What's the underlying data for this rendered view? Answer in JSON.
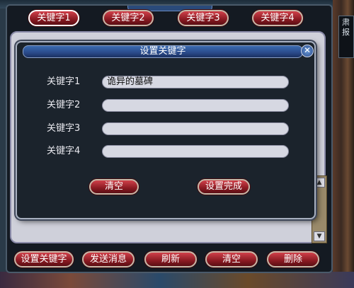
{
  "side_panel": {
    "text": "肃\n报"
  },
  "tabs": [
    {
      "label": "关键字1",
      "active": true
    },
    {
      "label": "关键字2",
      "active": false
    },
    {
      "label": "关键字3",
      "active": false
    },
    {
      "label": "关键字4",
      "active": false
    }
  ],
  "dialog": {
    "title": "设置关键字",
    "close_symbol": "✕",
    "fields": [
      {
        "label": "关键字1",
        "value": "诡异的墓碑"
      },
      {
        "label": "关键字2",
        "value": ""
      },
      {
        "label": "关键字3",
        "value": ""
      },
      {
        "label": "关键字4",
        "value": ""
      }
    ],
    "clear_label": "清空",
    "done_label": "设置完成"
  },
  "bottom_buttons": {
    "set_keyword": "设置关键字",
    "send_message": "发送消息",
    "refresh": "刷新",
    "clear": "清空",
    "delete": "删除"
  },
  "scroll": {
    "up": "▲",
    "down": "▼"
  },
  "colors": {
    "button_red": "#8a1a22",
    "title_blue": "#2a4a8a",
    "input_bg": "#d6d8e2",
    "dialog_bg": "#1b232c"
  },
  "icons": {
    "close": "close-icon",
    "scroll_up": "arrow-up-icon",
    "scroll_down": "arrow-down-icon"
  }
}
